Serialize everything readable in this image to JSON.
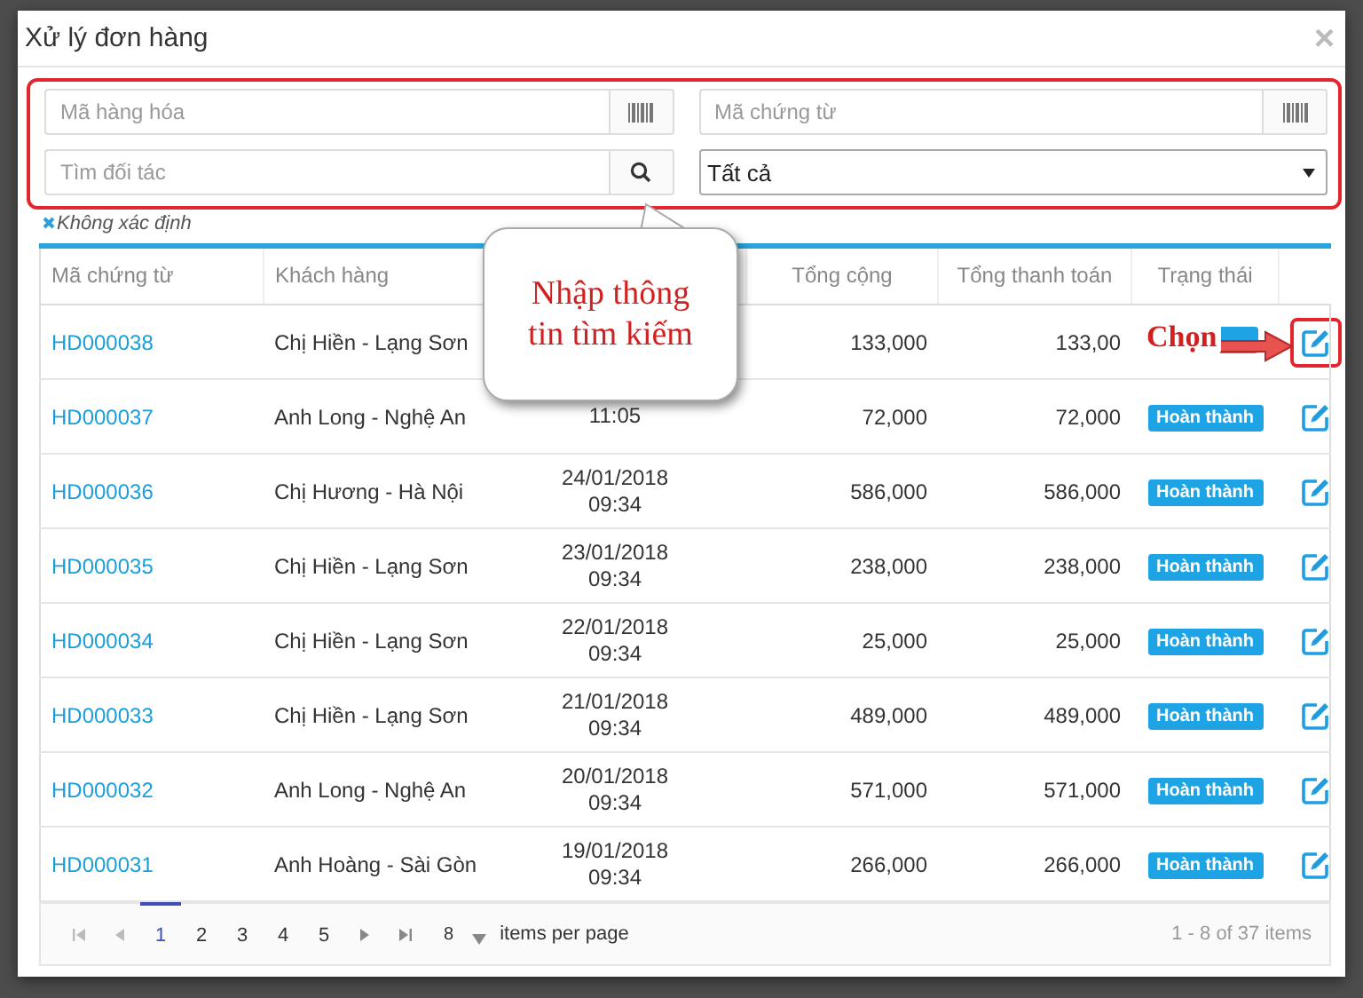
{
  "dialog": {
    "title": "Xử lý đơn hàng",
    "close": "×"
  },
  "filters": {
    "product_code": {
      "placeholder": "Mã hàng hóa"
    },
    "document_code": {
      "placeholder": "Mã chứng từ"
    },
    "partner": {
      "placeholder": "Tìm đối tác"
    },
    "status_select": {
      "value": "Tất cả"
    },
    "unknown_tag": "Không xác định"
  },
  "table": {
    "columns": [
      "Mã chứng từ",
      "Khách hàng",
      "Tổng cộng",
      "Tổng thanh toán",
      "Trạng thái"
    ],
    "rows": [
      {
        "code": "HD000038",
        "customer": "Chị Hiền - Lạng Sơn",
        "total": "133,000",
        "paid": "133,00",
        "badge_covered": true,
        "highlighted": true
      },
      {
        "code": "HD000037",
        "customer": "Anh Long - Nghệ An",
        "time": "11:05",
        "total": "72,000",
        "paid": "72,000",
        "status": "Hoàn thành",
        "highlighted": false
      },
      {
        "code": "HD000036",
        "customer": "Chị Hương - Hà Nội",
        "date": "24/01/2018",
        "time": "09:34",
        "total": "586,000",
        "paid": "586,000",
        "status": "Hoàn thành",
        "highlighted": false
      },
      {
        "code": "HD000035",
        "customer": "Chị Hiền - Lạng Sơn",
        "date": "23/01/2018",
        "time": "09:34",
        "total": "238,000",
        "paid": "238,000",
        "status": "Hoàn thành",
        "highlighted": false
      },
      {
        "code": "HD000034",
        "customer": "Chị Hiền - Lạng Sơn",
        "date": "22/01/2018",
        "time": "09:34",
        "total": "25,000",
        "paid": "25,000",
        "status": "Hoàn thành",
        "highlighted": false
      },
      {
        "code": "HD000033",
        "customer": "Chị Hiền - Lạng Sơn",
        "date": "21/01/2018",
        "time": "09:34",
        "total": "489,000",
        "paid": "489,000",
        "status": "Hoàn thành",
        "highlighted": false
      },
      {
        "code": "HD000032",
        "customer": "Anh Long - Nghệ An",
        "date": "20/01/2018",
        "time": "09:34",
        "total": "571,000",
        "paid": "571,000",
        "status": "Hoàn thành",
        "highlighted": false
      },
      {
        "code": "HD000031",
        "customer": "Anh Hoàng - Sài Gòn",
        "date": "19/01/2018",
        "time": "09:34",
        "total": "266,000",
        "paid": "266,000",
        "status": "Hoàn thành",
        "highlighted": false
      }
    ]
  },
  "pagination": {
    "pages": [
      {
        "label": "1",
        "selected": true
      },
      {
        "label": "2",
        "selected": false
      },
      {
        "label": "3",
        "selected": false
      },
      {
        "label": "4",
        "selected": false
      },
      {
        "label": "5",
        "selected": false
      }
    ],
    "page_size": "8",
    "page_size_label": "items per page",
    "summary": "1 - 8 of 37 items"
  },
  "annotations": {
    "search_callout": "Nhập thông tin tìm kiếm",
    "select_callout": "Chọn"
  }
}
